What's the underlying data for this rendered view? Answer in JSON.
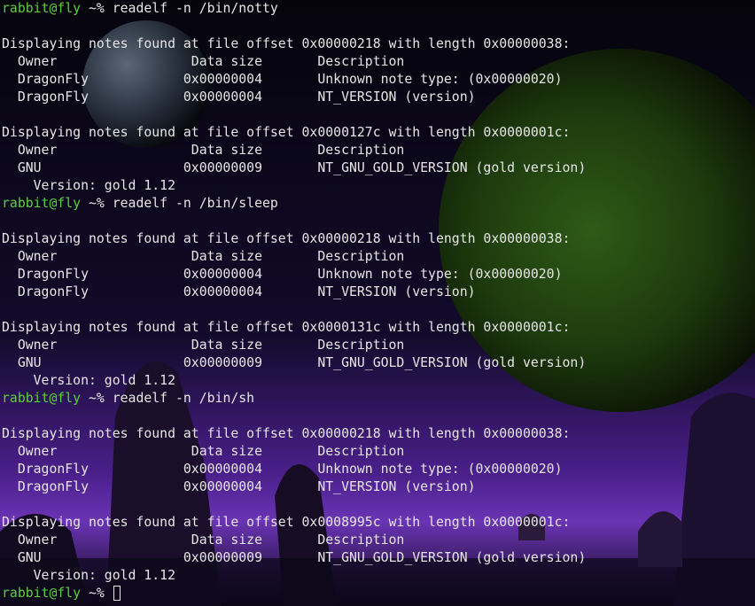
{
  "prompt": {
    "user_host": "rabbit@fly",
    "path_symbol": " ~% "
  },
  "lines": [
    {
      "type": "prompt",
      "command": "readelf -n /bin/notty"
    },
    {
      "type": "text",
      "text": ""
    },
    {
      "type": "text",
      "text": "Displaying notes found at file offset 0x00000218 with length 0x00000038:"
    },
    {
      "type": "text",
      "text": "  Owner                 Data size       Description"
    },
    {
      "type": "text",
      "text": "  DragonFly            0x00000004       Unknown note type: (0x00000020)"
    },
    {
      "type": "text",
      "text": "  DragonFly            0x00000004       NT_VERSION (version)"
    },
    {
      "type": "text",
      "text": ""
    },
    {
      "type": "text",
      "text": "Displaying notes found at file offset 0x0000127c with length 0x0000001c:"
    },
    {
      "type": "text",
      "text": "  Owner                 Data size       Description"
    },
    {
      "type": "text",
      "text": "  GNU                  0x00000009       NT_GNU_GOLD_VERSION (gold version)"
    },
    {
      "type": "text",
      "text": "    Version: gold 1.12"
    },
    {
      "type": "prompt",
      "command": "readelf -n /bin/sleep"
    },
    {
      "type": "text",
      "text": ""
    },
    {
      "type": "text",
      "text": "Displaying notes found at file offset 0x00000218 with length 0x00000038:"
    },
    {
      "type": "text",
      "text": "  Owner                 Data size       Description"
    },
    {
      "type": "text",
      "text": "  DragonFly            0x00000004       Unknown note type: (0x00000020)"
    },
    {
      "type": "text",
      "text": "  DragonFly            0x00000004       NT_VERSION (version)"
    },
    {
      "type": "text",
      "text": ""
    },
    {
      "type": "text",
      "text": "Displaying notes found at file offset 0x0000131c with length 0x0000001c:"
    },
    {
      "type": "text",
      "text": "  Owner                 Data size       Description"
    },
    {
      "type": "text",
      "text": "  GNU                  0x00000009       NT_GNU_GOLD_VERSION (gold version)"
    },
    {
      "type": "text",
      "text": "    Version: gold 1.12"
    },
    {
      "type": "prompt",
      "command": "readelf -n /bin/sh"
    },
    {
      "type": "text",
      "text": ""
    },
    {
      "type": "text",
      "text": "Displaying notes found at file offset 0x00000218 with length 0x00000038:"
    },
    {
      "type": "text",
      "text": "  Owner                 Data size       Description"
    },
    {
      "type": "text",
      "text": "  DragonFly            0x00000004       Unknown note type: (0x00000020)"
    },
    {
      "type": "text",
      "text": "  DragonFly            0x00000004       NT_VERSION (version)"
    },
    {
      "type": "text",
      "text": ""
    },
    {
      "type": "text",
      "text": "Displaying notes found at file offset 0x0008995c with length 0x0000001c:"
    },
    {
      "type": "text",
      "text": "  Owner                 Data size       Description"
    },
    {
      "type": "text",
      "text": "  GNU                  0x00000009       NT_GNU_GOLD_VERSION (gold version)"
    },
    {
      "type": "text",
      "text": "    Version: gold 1.12"
    },
    {
      "type": "prompt",
      "command": "",
      "cursor": true
    }
  ],
  "colors": {
    "prompt_user": "#5ad03c",
    "text": "#e6e6e6",
    "background": "#05040c",
    "planet": "#2a4a14",
    "nebula": "#5a2aa0"
  }
}
